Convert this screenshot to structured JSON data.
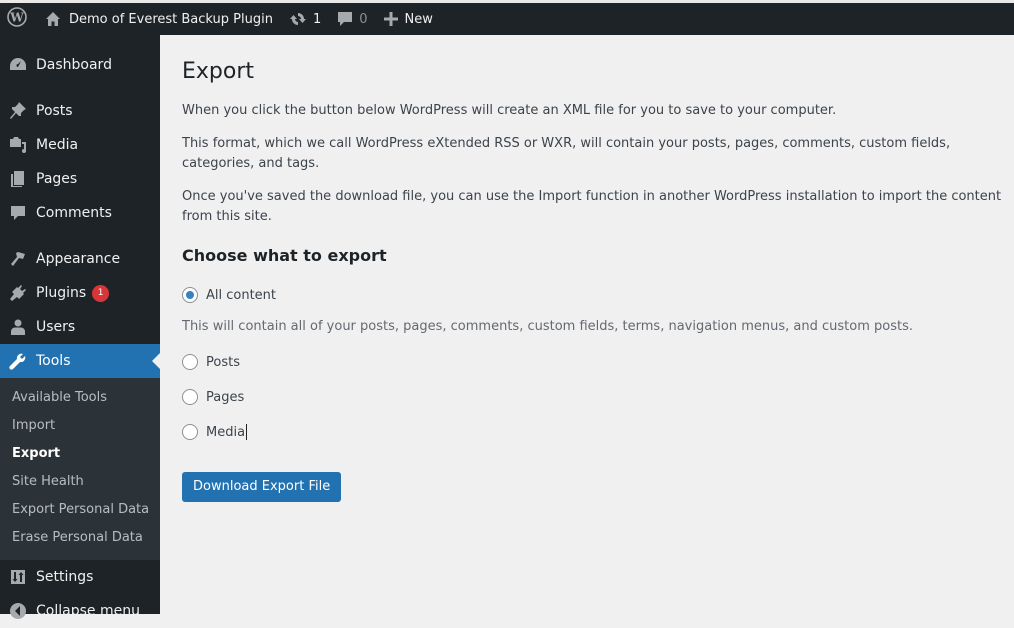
{
  "admin_bar": {
    "site_name": "Demo of Everest Backup Plugin",
    "updates_count": "1",
    "comments_count": "0",
    "new_label": "New"
  },
  "sidebar": {
    "items": [
      {
        "label": "Dashboard",
        "icon": "dashboard-icon"
      },
      {
        "label": "Posts",
        "icon": "pin-icon"
      },
      {
        "label": "Media",
        "icon": "media-icon"
      },
      {
        "label": "Pages",
        "icon": "pages-icon"
      },
      {
        "label": "Comments",
        "icon": "comment-icon"
      },
      {
        "label": "Appearance",
        "icon": "brush-icon"
      },
      {
        "label": "Plugins",
        "icon": "plugin-icon",
        "badge": "1"
      },
      {
        "label": "Users",
        "icon": "user-icon"
      },
      {
        "label": "Tools",
        "icon": "wrench-icon",
        "active": true
      },
      {
        "label": "Settings",
        "icon": "settings-icon"
      },
      {
        "label": "Collapse menu",
        "icon": "collapse-icon"
      }
    ],
    "tools_submenu": [
      {
        "label": "Available Tools"
      },
      {
        "label": "Import"
      },
      {
        "label": "Export",
        "current": true
      },
      {
        "label": "Site Health"
      },
      {
        "label": "Export Personal Data"
      },
      {
        "label": "Erase Personal Data"
      }
    ]
  },
  "main": {
    "title": "Export",
    "paragraphs": [
      "When you click the button below WordPress will create an XML file for you to save to your computer.",
      "This format, which we call WordPress eXtended RSS or WXR, will contain your posts, pages, comments, custom fields, categories, and tags.",
      "Once you've saved the download file, you can use the Import function in another WordPress installation to import the content from this site."
    ],
    "section_title": "Choose what to export",
    "options": [
      {
        "label": "All content",
        "checked": true
      },
      {
        "label": "Posts",
        "checked": false
      },
      {
        "label": "Pages",
        "checked": false
      },
      {
        "label": "Media",
        "checked": false
      }
    ],
    "all_content_description": "This will contain all of your posts, pages, comments, custom fields, terms, navigation menus, and custom posts.",
    "download_button": "Download Export File"
  },
  "colors": {
    "admin_bar_bg": "#1d2327",
    "accent": "#2271b1",
    "badge": "#d63638",
    "content_bg": "#f0f0f1"
  }
}
